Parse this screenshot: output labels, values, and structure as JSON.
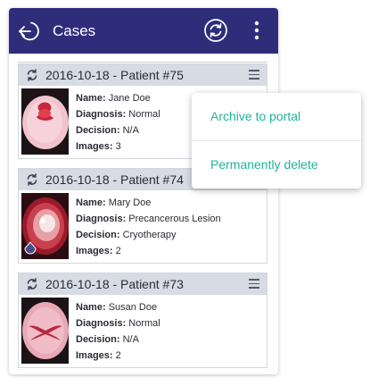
{
  "appbar": {
    "title": "Cases",
    "background": "#2e2d7a",
    "back_icon": "back-arrow-icon",
    "sync_icon": "sync-icon",
    "more_icon": "more-vertical-icon"
  },
  "labels": {
    "name": "Name:",
    "diagnosis": "Diagnosis:",
    "decision": "Decision:",
    "images": "Images:"
  },
  "cases": [
    {
      "title": "2016-10-18 - Patient #75",
      "name": "Jane Doe",
      "diagnosis": "Normal",
      "decision": "N/A",
      "images": "3"
    },
    {
      "title": "2016-10-18 - Patient #74",
      "name": "Mary Doe",
      "diagnosis": "Precancerous Lesion",
      "decision": "Cryotherapy",
      "images": "2"
    },
    {
      "title": "2016-10-18 - Patient #73",
      "name": "Susan Doe",
      "diagnosis": "Normal",
      "decision": "N/A",
      "images": "2"
    }
  ],
  "popup_menu": {
    "items": [
      "Archive to portal",
      "Permanently delete"
    ],
    "accent": "#1fb39a"
  }
}
